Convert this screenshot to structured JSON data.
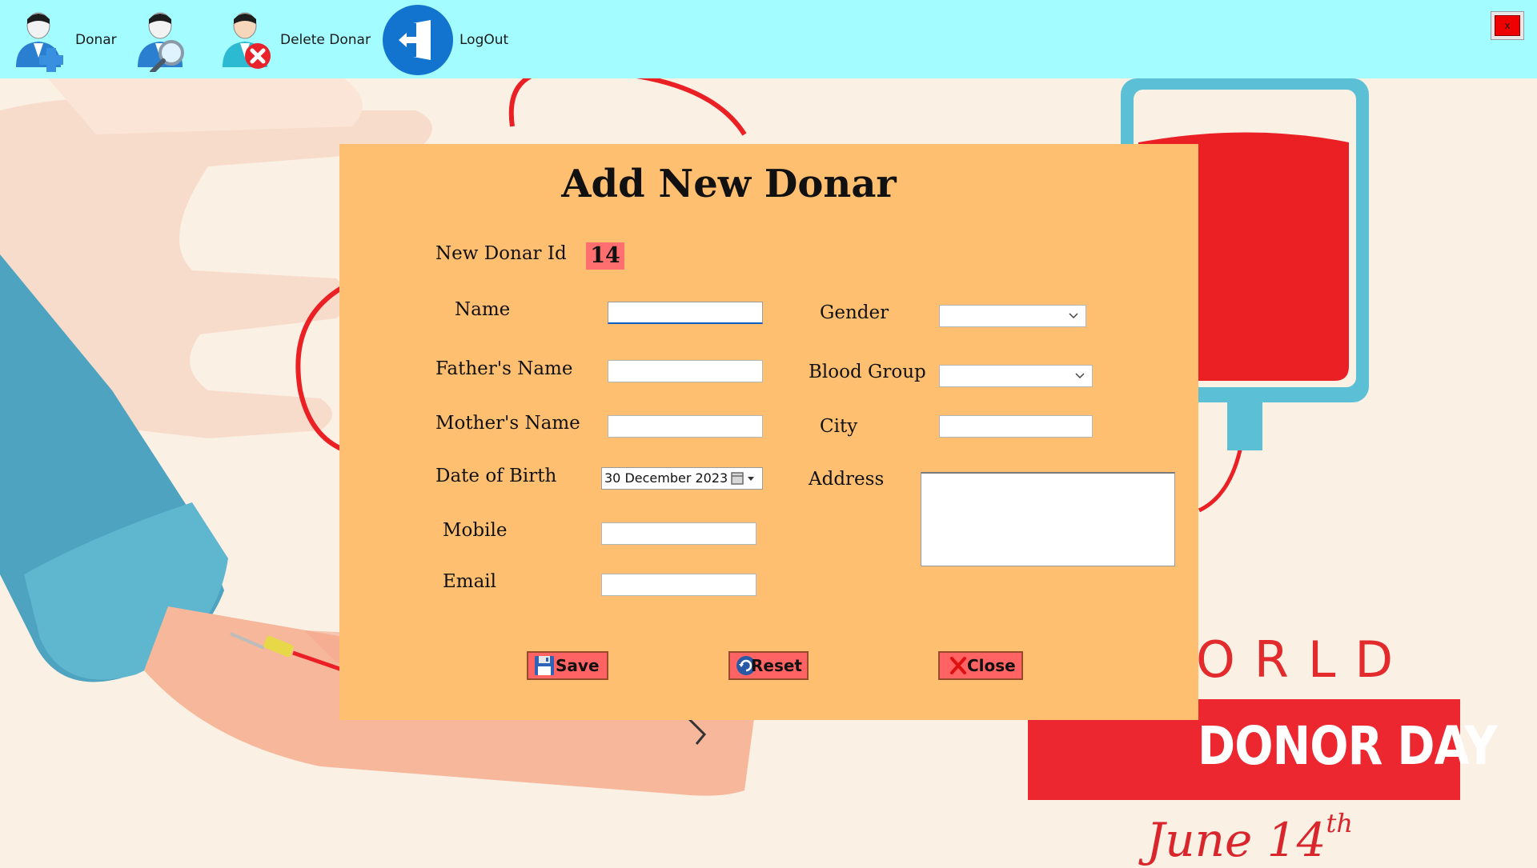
{
  "toolbar": {
    "items": [
      {
        "label": "Donar",
        "icon": "add-user-icon"
      },
      {
        "label": "",
        "icon": "search-user-icon"
      },
      {
        "label": "Delete Donar",
        "icon": "delete-user-icon"
      },
      {
        "label": "LogOut",
        "icon": "logout-icon"
      }
    ],
    "close_label": "x"
  },
  "poster": {
    "line1": "ORLD",
    "band": "DONOR DAY",
    "date": "June 14",
    "date_suffix": "th"
  },
  "form": {
    "title": "Add New Donar",
    "id_label": "New Donar Id",
    "id_value": "14",
    "name_label": "Name",
    "father_label": "Father's Name",
    "mother_label": "Mother's Name",
    "dob_label": "Date of Birth",
    "dob_value": "30 December 2023",
    "mobile_label": "Mobile",
    "email_label": "Email",
    "gender_label": "Gender",
    "blood_group_label": "Blood Group",
    "city_label": "City",
    "address_label": "Address",
    "name_value": "",
    "father_value": "",
    "mother_value": "",
    "mobile_value": "",
    "email_value": "",
    "gender_value": "",
    "blood_group_value": "",
    "city_value": "",
    "address_value": ""
  },
  "buttons": {
    "save": "Save",
    "reset": "Reset",
    "close": "Close"
  },
  "colors": {
    "toolbar_bg": "#a3fcff",
    "panel_bg": "#ffbf70",
    "button_bg": "#ff6363",
    "id_badge_bg": "#ff6f6f",
    "poster_red": "#ec2730"
  }
}
